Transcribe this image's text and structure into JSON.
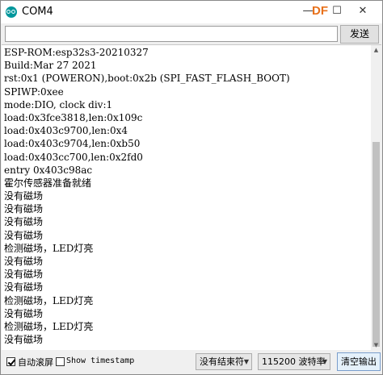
{
  "window": {
    "title": "COM4",
    "watermark": "DF",
    "minimize_glyph": "—",
    "maximize_glyph": "☐",
    "close_glyph": "✕"
  },
  "send": {
    "input_value": "",
    "button_label": "发送"
  },
  "output": {
    "lines": [
      "ESP-ROM:esp32s3-20210327",
      "Build:Mar 27 2021",
      "rst:0x1 (POWERON),boot:0x2b (SPI_FAST_FLASH_BOOT)",
      "SPIWP:0xee",
      "mode:DIO, clock div:1",
      "load:0x3fce3818,len:0x109c",
      "load:0x403c9700,len:0x4",
      "load:0x403c9704,len:0xb50",
      "load:0x403cc700,len:0x2fd0",
      "entry 0x403c98ac",
      "霍尔传感器准备就绪",
      "没有磁场",
      "没有磁场",
      "没有磁场",
      "没有磁场",
      "检测磁场，LED灯亮",
      "没有磁场",
      "没有磁场",
      "没有磁场",
      "检测磁场，LED灯亮",
      "没有磁场",
      "检测磁场，LED灯亮",
      "没有磁场"
    ]
  },
  "footer": {
    "autoscroll_label": "自动滚屏",
    "autoscroll_checked": true,
    "timestamp_label": "Show timestamp",
    "timestamp_checked": false,
    "line_ending_value": "没有结束符",
    "baud_value": "115200 波特率",
    "clear_label": "清空输出",
    "dropdown_arrow": "▼"
  },
  "colors": {
    "accent": "#00979c",
    "watermark": "#e8711b",
    "clear_button_border": "#7a9ecc"
  }
}
